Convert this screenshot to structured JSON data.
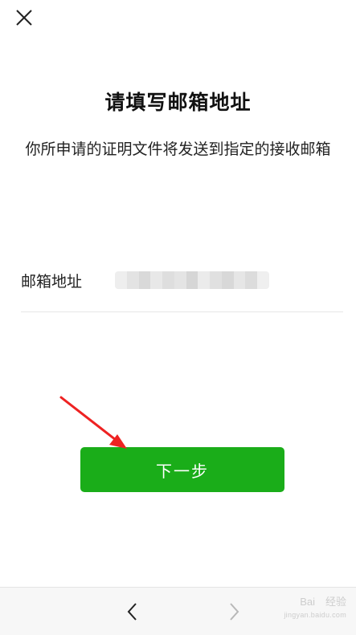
{
  "page": {
    "title": "请填写邮箱地址",
    "subtitle": "你所申请的证明文件将发送到指定的接收邮箱"
  },
  "form": {
    "email_label": "邮箱地址",
    "email_value_redacted": true
  },
  "buttons": {
    "next_label": "下一步"
  },
  "colors": {
    "primary": "#1aad19",
    "arrow": "#ee2222",
    "divider": "#e6e6e6",
    "bottom_bar": "#f7f7f7"
  },
  "icons": {
    "close": "close-icon",
    "back": "chevron-left-icon",
    "forward": "chevron-right-icon"
  },
  "watermark": {
    "brand": "Bai 经验",
    "url": "jingyan.baidu.com"
  }
}
